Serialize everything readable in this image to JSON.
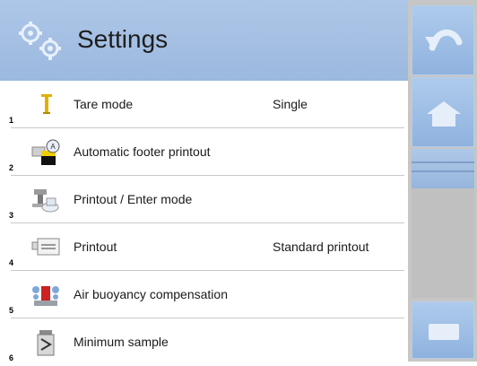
{
  "header": {
    "title": "Settings",
    "icon": "gears-icon"
  },
  "menu": {
    "items": [
      {
        "number": "1",
        "label": "Tare mode",
        "value": "Single",
        "icon": "tare-icon"
      },
      {
        "number": "2",
        "label": "Automatic footer printout",
        "value": "",
        "icon": "auto-printout-icon"
      },
      {
        "number": "3",
        "label": "Printout / Enter mode",
        "value": "",
        "icon": "printout-enter-icon"
      },
      {
        "number": "4",
        "label": "Printout",
        "value": "Standard printout",
        "icon": "printer-icon"
      },
      {
        "number": "5",
        "label": "Air buoyancy compensation",
        "value": "",
        "icon": "air-buoyancy-icon"
      },
      {
        "number": "6",
        "label": "Minimum sample",
        "value": "",
        "icon": "minimum-sample-icon"
      }
    ]
  },
  "sidebar": {
    "back_icon": "back-arrow-icon",
    "home_icon": "home-icon",
    "keyboard_icon": "keyboard-icon"
  },
  "colors": {
    "header_bg": "#a8c3e6",
    "sidebar_bg": "#c6c6c6",
    "button_bg": "#9fbde4"
  }
}
